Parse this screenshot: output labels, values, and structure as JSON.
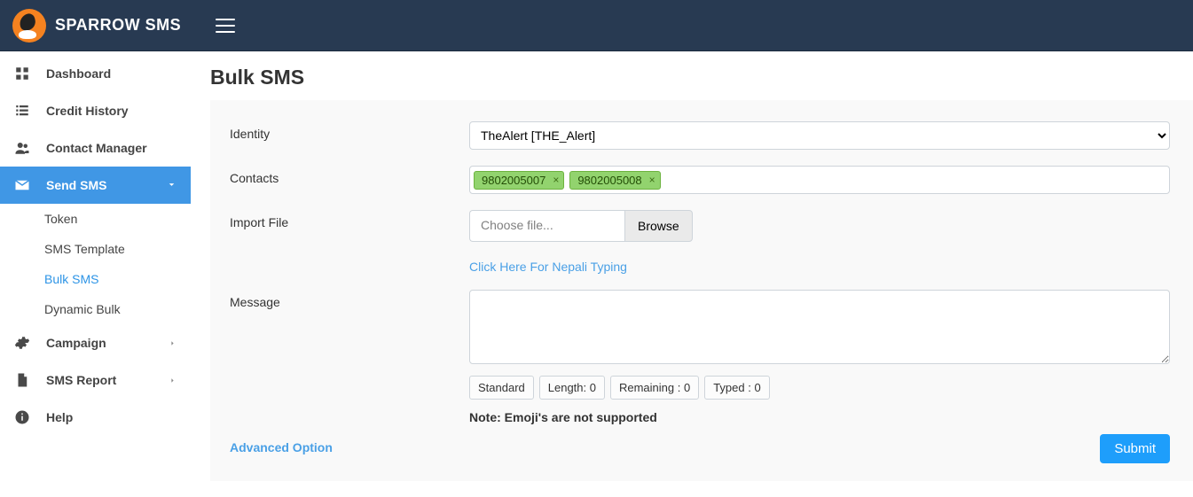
{
  "brand": "SPARROW SMS",
  "sidebar": {
    "items": [
      {
        "label": "Dashboard"
      },
      {
        "label": "Credit History"
      },
      {
        "label": "Contact Manager"
      },
      {
        "label": "Send SMS"
      },
      {
        "label": "Campaign"
      },
      {
        "label": "SMS Report"
      },
      {
        "label": "Help"
      }
    ],
    "send_sms_children": [
      {
        "label": "Token"
      },
      {
        "label": "SMS Template"
      },
      {
        "label": "Bulk SMS"
      },
      {
        "label": "Dynamic Bulk"
      }
    ]
  },
  "page": {
    "title": "Bulk SMS"
  },
  "form": {
    "identity": {
      "label": "Identity",
      "selected": "TheAlert [THE_Alert]"
    },
    "contacts": {
      "label": "Contacts",
      "tokens": [
        "9802005007",
        "9802005008"
      ]
    },
    "import": {
      "label": "Import File",
      "placeholder": "Choose file...",
      "browse": "Browse"
    },
    "nepali_link": "Click Here For Nepali Typing",
    "message": {
      "label": "Message"
    },
    "chips": {
      "mode": "Standard",
      "length": "Length: 0",
      "remaining": "Remaining : 0",
      "typed": "Typed : 0"
    },
    "note": "Note: Emoji's are not supported",
    "advanced": "Advanced Option",
    "submit": "Submit"
  }
}
